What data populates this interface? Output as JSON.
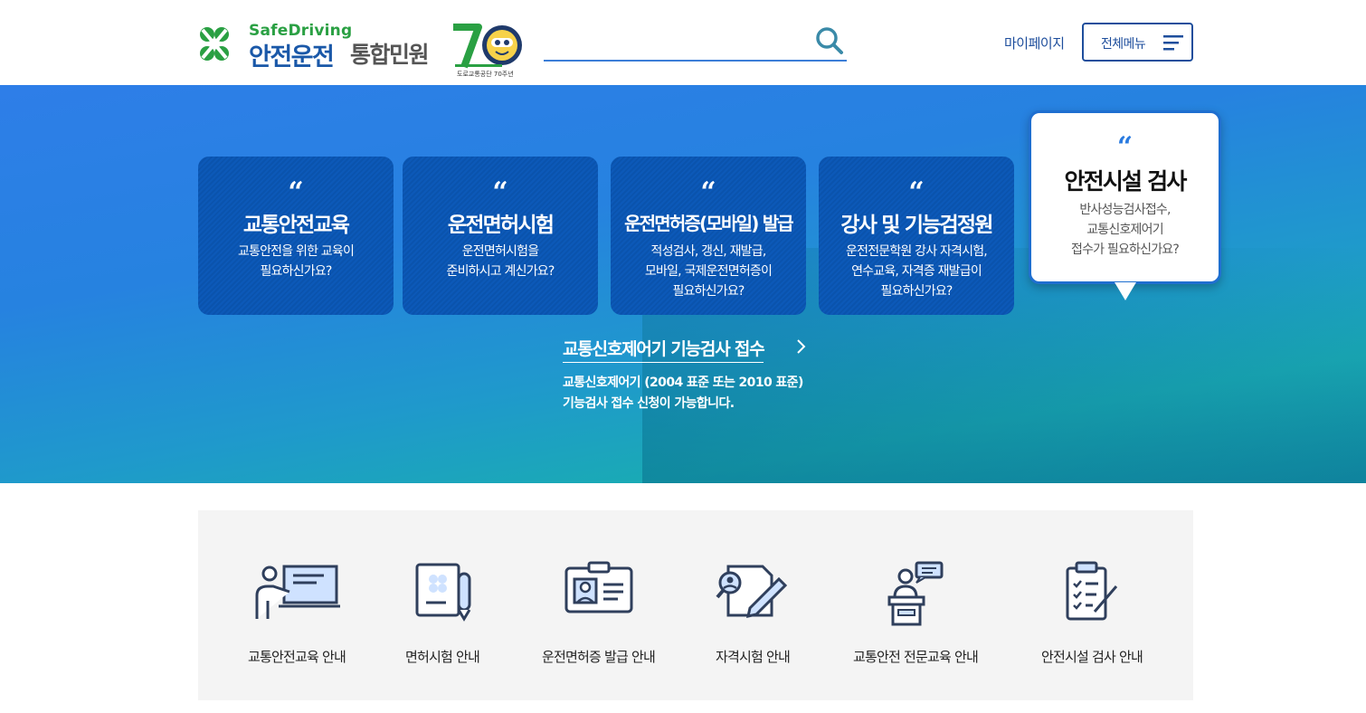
{
  "header": {
    "logo_en": "SafeDriving",
    "logo_ko": "안전운전",
    "logo_sub": "통합민원",
    "anniversary_caption": "도로교통공단 70주년",
    "search_placeholder": "",
    "mypage_label": "마이페이지",
    "allmenu_label": "전체메뉴"
  },
  "hero": {
    "cards": [
      {
        "title": "교통안전교육",
        "desc": "교통안전을 위한 교육이\n필요하신가요?"
      },
      {
        "title": "운전면허시험",
        "desc": "운전면허시험을\n준비하시고 계신가요?"
      },
      {
        "title": "운전면허증(모바일) 발급",
        "desc": "적성검사, 갱신, 재발급,\n모바일, 국제운전면허증이\n필요하신가요?"
      },
      {
        "title": "강사 및 기능검정원",
        "desc": "운전전문학원 강사 자격시험,\n연수교육, 자격증 재발급이\n필요하신가요?"
      },
      {
        "title": "안전시설 검사",
        "desc": "반사성능검사접수,\n교통신호제어기\n접수가 필요하신가요?"
      }
    ],
    "active_index": 4,
    "link_label": "교통신호제어기 기능검사 접수",
    "link_desc": "교통신호제어기 (2004 표준 또는 2010 표준)\n기능검사 접수 신청이 가능합니다."
  },
  "quick_menu": [
    {
      "label": "교통안전교육 안내",
      "icon": "presentation-icon"
    },
    {
      "label": "면허시험 안내",
      "icon": "exam-document-icon"
    },
    {
      "label": "운전면허증 발급 안내",
      "icon": "id-card-icon"
    },
    {
      "label": "자격시험 안내",
      "icon": "search-document-pen-icon"
    },
    {
      "label": "교통안전 전문교육 안내",
      "icon": "podium-speaker-icon"
    },
    {
      "label": "안전시설 검사 안내",
      "icon": "clipboard-checklist-icon"
    }
  ],
  "colors": {
    "brand_blue": "#1a58a8",
    "brand_green": "#2aa043",
    "accent": "#2a7be0",
    "card_bg": "#0c59b8"
  }
}
